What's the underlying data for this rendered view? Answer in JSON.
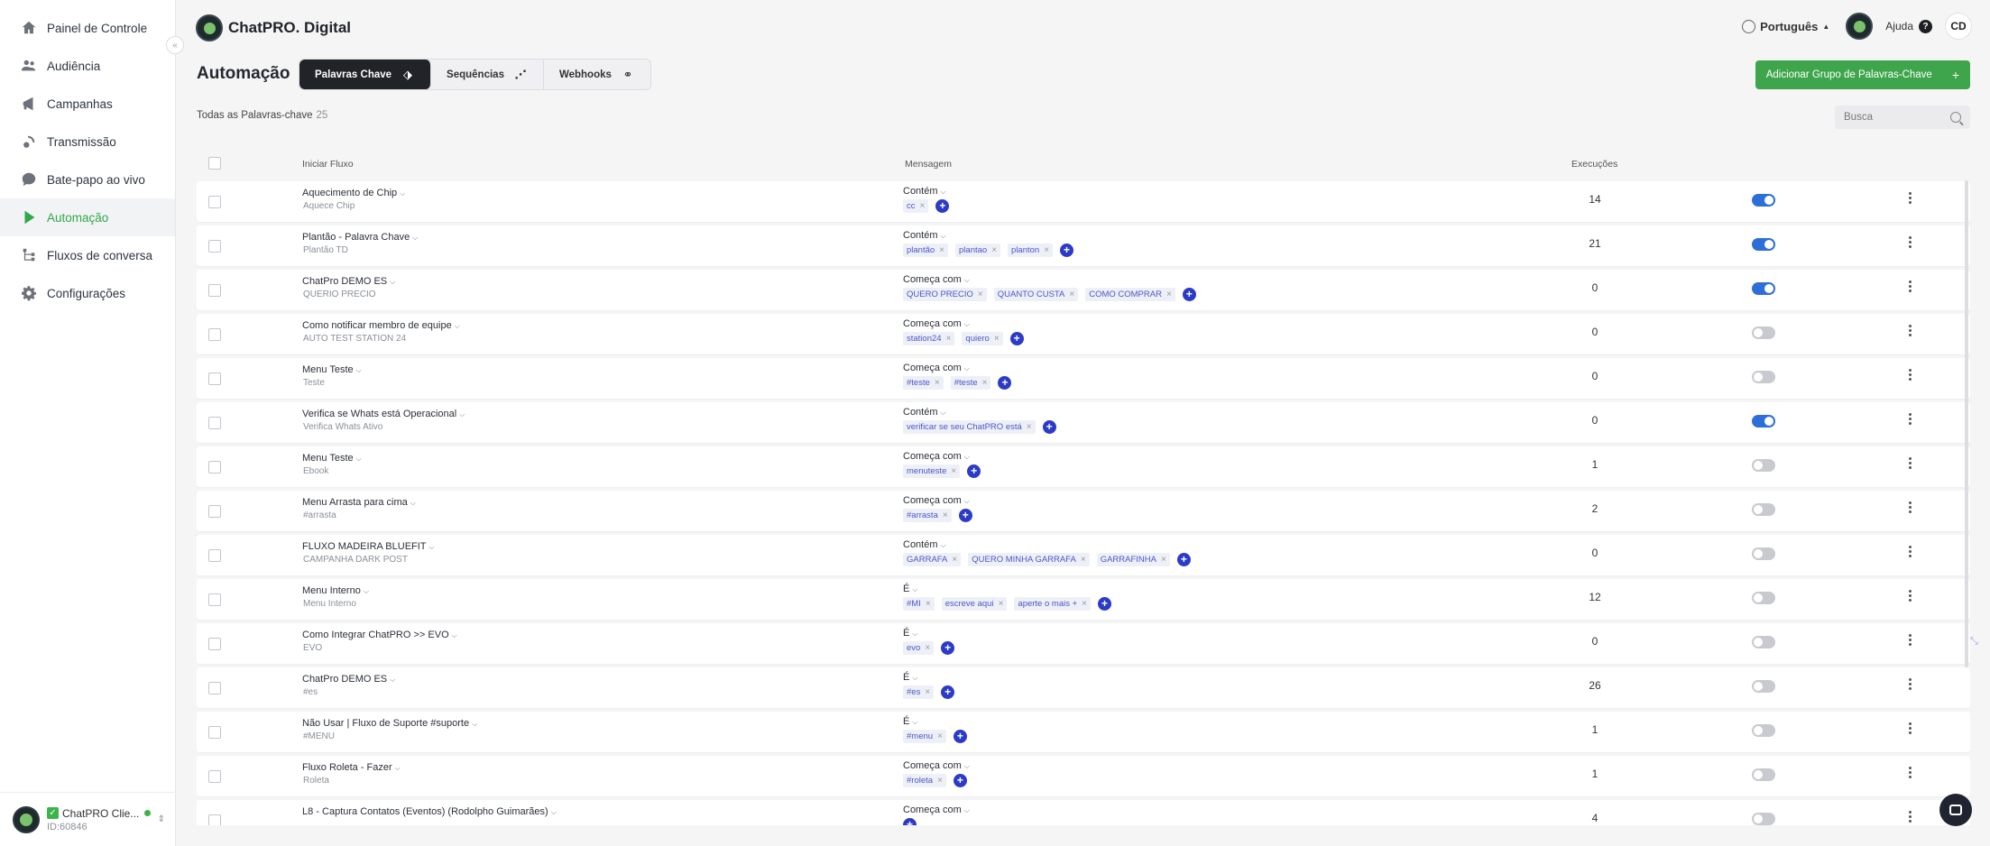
{
  "sidebar": {
    "items": [
      {
        "label": "Painel de Controle",
        "icon": "home-icon",
        "active": false
      },
      {
        "label": "Audiência",
        "icon": "users-icon",
        "active": false
      },
      {
        "label": "Campanhas",
        "icon": "campaign-icon",
        "active": false
      },
      {
        "label": "Transmissão",
        "icon": "broadcast-icon",
        "active": false
      },
      {
        "label": "Bate-papo ao vivo",
        "icon": "chat-icon",
        "active": false
      },
      {
        "label": "Automação",
        "icon": "automation-icon",
        "active": true
      },
      {
        "label": "Fluxos de conversa",
        "icon": "flow-icon",
        "active": false
      },
      {
        "label": "Configurações",
        "icon": "gear-icon",
        "active": false
      }
    ],
    "footer": {
      "name": "ChatPRO Clie...",
      "id": "ID:60846"
    }
  },
  "header": {
    "brand": "ChatPRO. Digital",
    "language": "Português",
    "help": "Ajuda",
    "initials": "CD"
  },
  "page": {
    "title": "Automação",
    "tabs": [
      {
        "label": "Palavras Chave",
        "icon": "tag-icon",
        "active": true
      },
      {
        "label": "Sequências",
        "icon": "sequence-icon",
        "active": false
      },
      {
        "label": "Webhooks",
        "icon": "webhook-icon",
        "active": false
      }
    ],
    "add_button": "Adicionar Grupo de Palavras-Chave",
    "count_label": "Todas as Palavras-chave",
    "count": "25",
    "search_placeholder": "Busca"
  },
  "table": {
    "headers": {
      "flow": "Iniciar Fluxo",
      "message": "Mensagem",
      "executions": "Execuções"
    },
    "rows": [
      {
        "flow": "Aquecimento de Chip",
        "sub": "Aquece Chip",
        "type": "Contém",
        "keywords": [
          "cc"
        ],
        "executions": "14",
        "enabled": true
      },
      {
        "flow": "Plantão - Palavra Chave",
        "sub": "Plantão TD",
        "type": "Contém",
        "keywords": [
          "plantão",
          "plantao",
          "planton"
        ],
        "executions": "21",
        "enabled": true
      },
      {
        "flow": "ChatPro DEMO ES",
        "sub": "QUERIO PRECIO",
        "type": "Começa com",
        "keywords": [
          "QUERO PRECIO",
          "QUANTO CUSTA",
          "COMO COMPRAR"
        ],
        "executions": "0",
        "enabled": true
      },
      {
        "flow": "Como notificar membro de equipe",
        "sub": "AUTO TEST STATION 24",
        "type": "Começa com",
        "keywords": [
          "station24",
          "quiero"
        ],
        "executions": "0",
        "enabled": false
      },
      {
        "flow": "Menu Teste",
        "sub": "Teste",
        "type": "Começa com",
        "keywords": [
          "#teste",
          "#teste"
        ],
        "executions": "0",
        "enabled": false
      },
      {
        "flow": "Verifica se Whats está Operacional",
        "sub": "Verifica Whats Ativo",
        "type": "Contém",
        "keywords": [
          "verificar se seu ChatPRO está"
        ],
        "executions": "0",
        "enabled": true
      },
      {
        "flow": "Menu Teste",
        "sub": "Ebook",
        "type": "Começa com",
        "keywords": [
          "menuteste"
        ],
        "executions": "1",
        "enabled": false
      },
      {
        "flow": "Menu Arrasta para cima",
        "sub": "#arrasta",
        "type": "Começa com",
        "keywords": [
          "#arrasta"
        ],
        "executions": "2",
        "enabled": false
      },
      {
        "flow": "FLUXO MADEIRA BLUEFIT",
        "sub": "CAMPANHA DARK POST",
        "type": "Contém",
        "keywords": [
          "GARRAFA",
          "QUERO MINHA GARRAFA",
          "GARRAFINHA"
        ],
        "executions": "0",
        "enabled": false
      },
      {
        "flow": "Menu Interno",
        "sub": "Menu Interno",
        "type": "É",
        "keywords": [
          "#MI",
          "escreve aqui",
          "aperte o mais +"
        ],
        "executions": "12",
        "enabled": false
      },
      {
        "flow": "Como Integrar ChatPRO >> EVO",
        "sub": "EVO",
        "type": "É",
        "keywords": [
          "evo"
        ],
        "executions": "0",
        "enabled": false
      },
      {
        "flow": "ChatPro DEMO ES",
        "sub": "#es",
        "type": "É",
        "keywords": [
          "#es"
        ],
        "executions": "26",
        "enabled": false
      },
      {
        "flow": "Não Usar | Fluxo de Suporte #suporte",
        "sub": "#MENU",
        "type": "É",
        "keywords": [
          "#menu"
        ],
        "executions": "1",
        "enabled": false
      },
      {
        "flow": "Fluxo Roleta - Fazer",
        "sub": "Roleta",
        "type": "Começa com",
        "keywords": [
          "#roleta"
        ],
        "executions": "1",
        "enabled": false
      },
      {
        "flow": "L8 - Captura Contatos (Eventos) (Rodolpho Guimarães)",
        "sub": "",
        "type": "Começa com",
        "keywords": [],
        "executions": "4",
        "enabled": false
      }
    ]
  }
}
